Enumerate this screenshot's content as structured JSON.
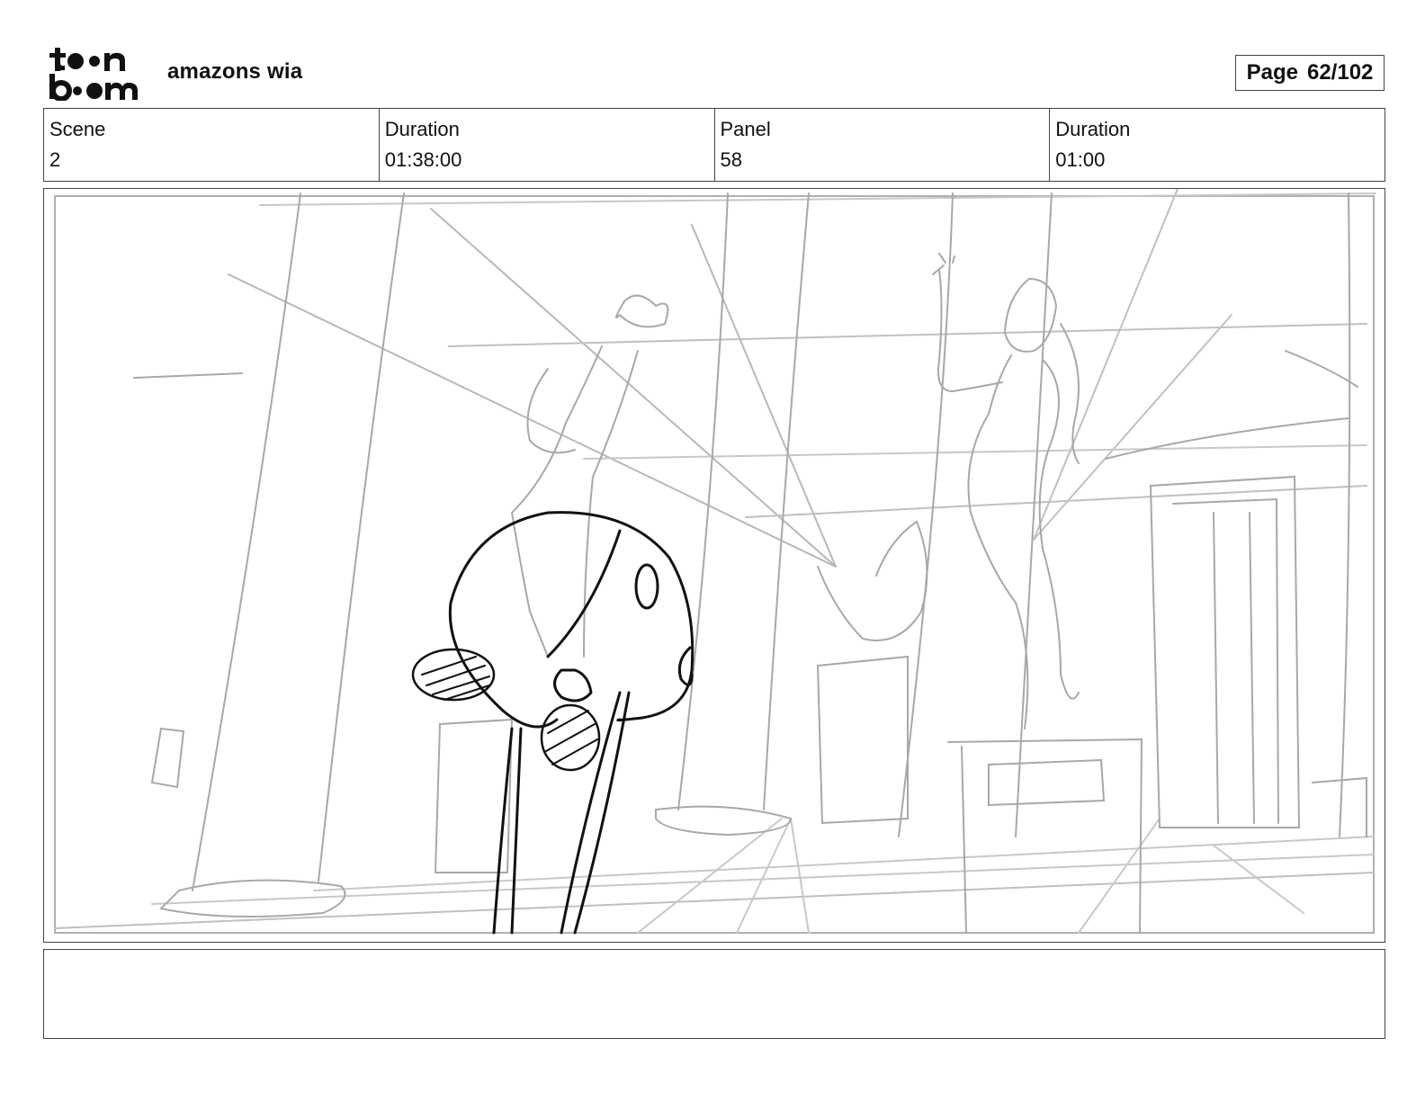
{
  "header": {
    "project_title": "amazons wia",
    "page_label": "Page",
    "page_value": "62/102"
  },
  "logo": {
    "icon": "toon-boom-logo",
    "text_line1": "toon",
    "text_line2": "boom"
  },
  "info": {
    "scene_label": "Scene",
    "scene_value": "2",
    "scene_duration_label": "Duration",
    "scene_duration_value": "01:38:00",
    "panel_label": "Panel",
    "panel_value": "58",
    "panel_duration_label": "Duration",
    "panel_duration_value": "01:00"
  },
  "panel_image": {
    "icon": "storyboard-sketch",
    "line_color": "#9a9a9a",
    "ink_color": "#111111"
  },
  "caption": {
    "text": ""
  }
}
